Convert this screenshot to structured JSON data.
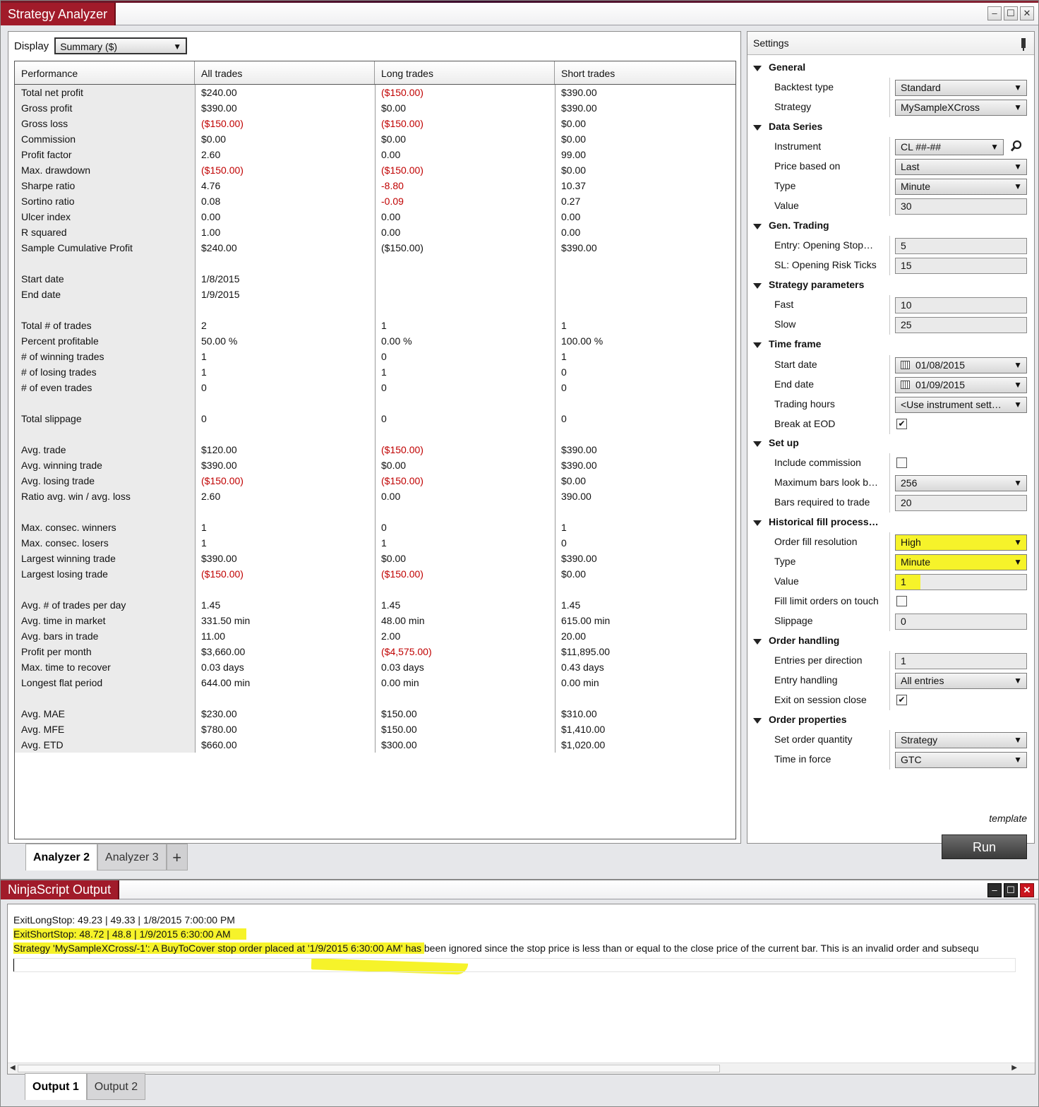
{
  "analyzer": {
    "title": "Strategy Analyzer",
    "display_label": "Display",
    "display_value": "Summary ($)",
    "columns": [
      "Performance",
      "All trades",
      "Long trades",
      "Short trades"
    ],
    "rows": [
      {
        "label": "Total net profit",
        "all": "$240.00",
        "long": "($150.00)",
        "short": "$390.00",
        "neg": [
          false,
          true,
          false
        ]
      },
      {
        "label": "Gross profit",
        "all": "$390.00",
        "long": "$0.00",
        "short": "$390.00",
        "neg": [
          false,
          false,
          false
        ]
      },
      {
        "label": "Gross loss",
        "all": "($150.00)",
        "long": "($150.00)",
        "short": "$0.00",
        "neg": [
          true,
          true,
          false
        ]
      },
      {
        "label": "Commission",
        "all": "$0.00",
        "long": "$0.00",
        "short": "$0.00",
        "neg": [
          false,
          false,
          false
        ]
      },
      {
        "label": "Profit factor",
        "all": "2.60",
        "long": "0.00",
        "short": "99.00",
        "neg": [
          false,
          false,
          false
        ]
      },
      {
        "label": "Max. drawdown",
        "all": "($150.00)",
        "long": "($150.00)",
        "short": "$0.00",
        "neg": [
          true,
          true,
          false
        ]
      },
      {
        "label": "Sharpe ratio",
        "all": "4.76",
        "long": "-8.80",
        "short": "10.37",
        "neg": [
          false,
          true,
          false
        ]
      },
      {
        "label": "Sortino ratio",
        "all": "0.08",
        "long": "-0.09",
        "short": "0.27",
        "neg": [
          false,
          true,
          false
        ]
      },
      {
        "label": "Ulcer index",
        "all": "0.00",
        "long": "0.00",
        "short": "0.00",
        "neg": [
          false,
          false,
          false
        ]
      },
      {
        "label": "R squared",
        "all": "1.00",
        "long": "0.00",
        "short": "0.00",
        "neg": [
          false,
          false,
          false
        ]
      },
      {
        "label": "Sample Cumulative Profit",
        "all": "$240.00",
        "long": "($150.00)",
        "short": "$390.00",
        "neg": [
          false,
          false,
          false
        ]
      },
      {
        "label": "",
        "all": "",
        "long": "",
        "short": "",
        "neg": [
          false,
          false,
          false
        ]
      },
      {
        "label": "Start date",
        "all": "1/8/2015",
        "long": "",
        "short": "",
        "neg": [
          false,
          false,
          false
        ]
      },
      {
        "label": "End date",
        "all": "1/9/2015",
        "long": "",
        "short": "",
        "neg": [
          false,
          false,
          false
        ]
      },
      {
        "label": "",
        "all": "",
        "long": "",
        "short": "",
        "neg": [
          false,
          false,
          false
        ]
      },
      {
        "label": "Total # of trades",
        "all": "2",
        "long": "1",
        "short": "1",
        "neg": [
          false,
          false,
          false
        ]
      },
      {
        "label": "Percent profitable",
        "all": "50.00 %",
        "long": "0.00 %",
        "short": "100.00 %",
        "neg": [
          false,
          false,
          false
        ]
      },
      {
        "label": "# of winning trades",
        "all": "1",
        "long": "0",
        "short": "1",
        "neg": [
          false,
          false,
          false
        ]
      },
      {
        "label": "# of losing trades",
        "all": "1",
        "long": "1",
        "short": "0",
        "neg": [
          false,
          false,
          false
        ]
      },
      {
        "label": "# of even trades",
        "all": "0",
        "long": "0",
        "short": "0",
        "neg": [
          false,
          false,
          false
        ]
      },
      {
        "label": "",
        "all": "",
        "long": "",
        "short": "",
        "neg": [
          false,
          false,
          false
        ]
      },
      {
        "label": "Total slippage",
        "all": "0",
        "long": "0",
        "short": "0",
        "neg": [
          false,
          false,
          false
        ]
      },
      {
        "label": "",
        "all": "",
        "long": "",
        "short": "",
        "neg": [
          false,
          false,
          false
        ]
      },
      {
        "label": "Avg. trade",
        "all": "$120.00",
        "long": "($150.00)",
        "short": "$390.00",
        "neg": [
          false,
          true,
          false
        ]
      },
      {
        "label": "Avg. winning trade",
        "all": "$390.00",
        "long": "$0.00",
        "short": "$390.00",
        "neg": [
          false,
          false,
          false
        ]
      },
      {
        "label": "Avg. losing trade",
        "all": "($150.00)",
        "long": "($150.00)",
        "short": "$0.00",
        "neg": [
          true,
          true,
          false
        ]
      },
      {
        "label": "Ratio avg. win / avg. loss",
        "all": "2.60",
        "long": "0.00",
        "short": "390.00",
        "neg": [
          false,
          false,
          false
        ]
      },
      {
        "label": "",
        "all": "",
        "long": "",
        "short": "",
        "neg": [
          false,
          false,
          false
        ]
      },
      {
        "label": "Max. consec. winners",
        "all": "1",
        "long": "0",
        "short": "1",
        "neg": [
          false,
          false,
          false
        ]
      },
      {
        "label": "Max. consec. losers",
        "all": "1",
        "long": "1",
        "short": "0",
        "neg": [
          false,
          false,
          false
        ]
      },
      {
        "label": "Largest winning trade",
        "all": "$390.00",
        "long": "$0.00",
        "short": "$390.00",
        "neg": [
          false,
          false,
          false
        ]
      },
      {
        "label": "Largest losing trade",
        "all": "($150.00)",
        "long": "($150.00)",
        "short": "$0.00",
        "neg": [
          true,
          true,
          false
        ]
      },
      {
        "label": "",
        "all": "",
        "long": "",
        "short": "",
        "neg": [
          false,
          false,
          false
        ]
      },
      {
        "label": "Avg. # of trades per day",
        "all": "1.45",
        "long": "1.45",
        "short": "1.45",
        "neg": [
          false,
          false,
          false
        ]
      },
      {
        "label": "Avg. time in market",
        "all": "331.50 min",
        "long": "48.00 min",
        "short": "615.00 min",
        "neg": [
          false,
          false,
          false
        ]
      },
      {
        "label": "Avg. bars in trade",
        "all": "11.00",
        "long": "2.00",
        "short": "20.00",
        "neg": [
          false,
          false,
          false
        ]
      },
      {
        "label": "Profit per month",
        "all": "$3,660.00",
        "long": "($4,575.00)",
        "short": "$11,895.00",
        "neg": [
          false,
          true,
          false
        ]
      },
      {
        "label": "Max. time to recover",
        "all": "0.03 days",
        "long": "0.03 days",
        "short": "0.43 days",
        "neg": [
          false,
          false,
          false
        ]
      },
      {
        "label": "Longest flat period",
        "all": "644.00 min",
        "long": "0.00 min",
        "short": "0.00 min",
        "neg": [
          false,
          false,
          false
        ]
      },
      {
        "label": "",
        "all": "",
        "long": "",
        "short": "",
        "neg": [
          false,
          false,
          false
        ]
      },
      {
        "label": "Avg. MAE",
        "all": "$230.00",
        "long": "$150.00",
        "short": "$310.00",
        "neg": [
          false,
          false,
          false
        ]
      },
      {
        "label": "Avg. MFE",
        "all": "$780.00",
        "long": "$150.00",
        "short": "$1,410.00",
        "neg": [
          false,
          false,
          false
        ]
      },
      {
        "label": "Avg. ETD",
        "all": "$660.00",
        "long": "$300.00",
        "short": "$1,020.00",
        "neg": [
          false,
          false,
          false
        ]
      }
    ],
    "tabs": [
      "Analyzer 2",
      "Analyzer 3",
      "+"
    ],
    "colors": {
      "negative": "#c00000",
      "title_red": "#a11b2a",
      "highlight": "#f6f32a"
    }
  },
  "settings": {
    "title": "Settings",
    "template_label": "template",
    "run_label": "Run",
    "items": [
      {
        "kind": "cat",
        "label": "General"
      },
      {
        "kind": "prop",
        "label": "Backtest type",
        "type": "combo",
        "value": "Standard"
      },
      {
        "kind": "prop",
        "label": "Strategy",
        "type": "combo",
        "value": "MySampleXCross"
      },
      {
        "kind": "cat",
        "label": "Data Series"
      },
      {
        "kind": "prop",
        "label": "Instrument",
        "type": "instrument",
        "value": "CL ##-##"
      },
      {
        "kind": "prop",
        "label": "Price based on",
        "type": "combo",
        "value": "Last"
      },
      {
        "kind": "prop",
        "label": "Type",
        "type": "combo",
        "value": "Minute"
      },
      {
        "kind": "prop",
        "label": "Value",
        "type": "text",
        "value": "30"
      },
      {
        "kind": "cat",
        "label": "Gen. Trading"
      },
      {
        "kind": "prop",
        "label": "Entry: Opening Stop…",
        "type": "text",
        "value": "5"
      },
      {
        "kind": "prop",
        "label": "SL: Opening Risk Ticks",
        "type": "text",
        "value": "15"
      },
      {
        "kind": "cat",
        "label": "Strategy parameters"
      },
      {
        "kind": "prop",
        "label": "Fast",
        "type": "text",
        "value": "10"
      },
      {
        "kind": "prop",
        "label": "Slow",
        "type": "text",
        "value": "25"
      },
      {
        "kind": "cat",
        "label": "Time frame"
      },
      {
        "kind": "prop",
        "label": "Start date",
        "type": "date",
        "value": "01/08/2015"
      },
      {
        "kind": "prop",
        "label": "End date",
        "type": "date",
        "value": "01/09/2015"
      },
      {
        "kind": "prop",
        "label": "Trading hours",
        "type": "combo",
        "value": "<Use instrument sett…"
      },
      {
        "kind": "prop",
        "label": "Break at EOD",
        "type": "check",
        "value": "✔"
      },
      {
        "kind": "cat",
        "label": "Set up"
      },
      {
        "kind": "prop",
        "label": "Include commission",
        "type": "check",
        "value": ""
      },
      {
        "kind": "prop",
        "label": "Maximum bars look b…",
        "type": "combo",
        "value": "256"
      },
      {
        "kind": "prop",
        "label": "Bars required to trade",
        "type": "text",
        "value": "20"
      },
      {
        "kind": "cat",
        "label": "Historical fill process…"
      },
      {
        "kind": "prop",
        "label": "Order fill resolution",
        "type": "combo",
        "value": "High",
        "hl": true
      },
      {
        "kind": "prop",
        "label": "Type",
        "type": "combo",
        "value": "Minute",
        "hl": true
      },
      {
        "kind": "prop",
        "label": "Value",
        "type": "text",
        "value": "1",
        "hl": true
      },
      {
        "kind": "prop",
        "label": "Fill limit orders on touch",
        "type": "check",
        "value": ""
      },
      {
        "kind": "prop",
        "label": "Slippage",
        "type": "text",
        "value": "0"
      },
      {
        "kind": "cat",
        "label": "Order handling"
      },
      {
        "kind": "prop",
        "label": "Entries per direction",
        "type": "text",
        "value": "1"
      },
      {
        "kind": "prop",
        "label": "Entry handling",
        "type": "combo",
        "value": "All entries"
      },
      {
        "kind": "prop",
        "label": "Exit on session close",
        "type": "check",
        "value": "✔"
      },
      {
        "kind": "cat",
        "label": "Order properties"
      },
      {
        "kind": "prop",
        "label": "Set order quantity",
        "type": "combo",
        "value": "Strategy"
      },
      {
        "kind": "prop",
        "label": "Time in force",
        "type": "combo",
        "value": "GTC"
      }
    ]
  },
  "output": {
    "title": "NinjaScript Output",
    "lines": [
      "ExitLongStop: 49.23 | 49.33 | 1/8/2015 7:00:00 PM",
      "ExitShortStop: 48.72 | 48.8 | 1/9/2015 6:30:00 AM",
      "Strategy 'MySampleXCross/-1': A BuyToCover stop order placed at '1/9/2015 6:30:00 AM' has been ignored since the stop price is less than or equal to the close price of the current bar. This is an invalid order and subsequ"
    ],
    "tabs": [
      "Output 1",
      "Output 2"
    ]
  }
}
